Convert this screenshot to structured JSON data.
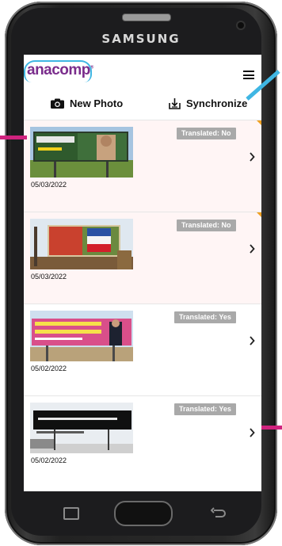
{
  "device": {
    "brand": "SAMSUNG"
  },
  "app": {
    "logo_text": "anacomp",
    "logo_mark": "®"
  },
  "toolbar": {
    "new_photo_label": "New Photo",
    "sync_label": "Synchronize"
  },
  "photos": [
    {
      "date": "05/03/2022",
      "badge": "Translated: No",
      "synced": false
    },
    {
      "date": "05/03/2022",
      "badge": "Translated: No",
      "synced": false
    },
    {
      "date": "05/02/2022",
      "badge": "Translated: Yes",
      "synced": true
    },
    {
      "date": "05/02/2022",
      "badge": "Translated: Yes",
      "synced": true
    }
  ],
  "colors": {
    "accent_cyan": "#3fb6e3",
    "pointer_magenta": "#d0237e",
    "badge_gray": "#a9a9a9",
    "unsynced_corner": "#f0a020",
    "logo_purple": "#7a2d8c"
  },
  "icons": {
    "camera": "camera-icon",
    "sync": "download-tray-icon",
    "menu": "hamburger-menu-icon",
    "chevron": "chevron-right-icon"
  }
}
